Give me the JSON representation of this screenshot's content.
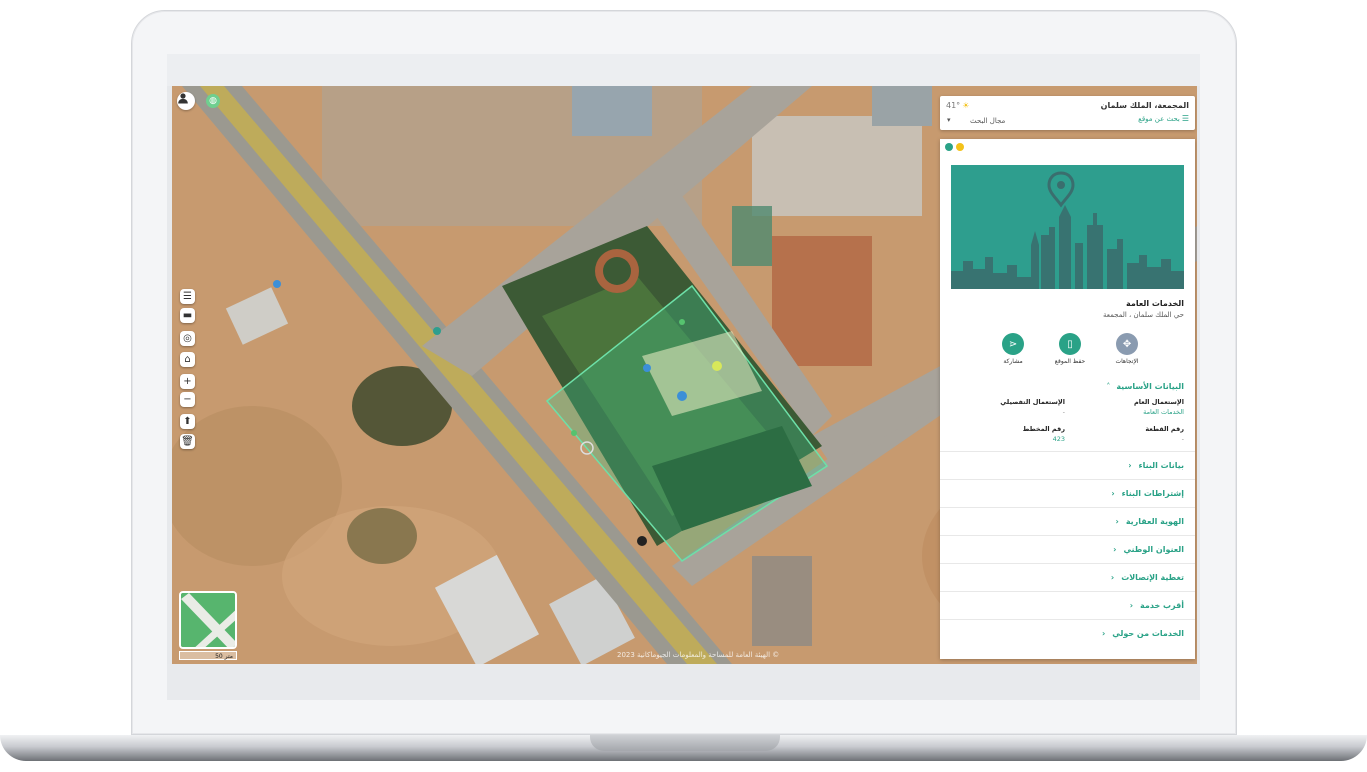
{
  "search": {
    "place": "المجمعة، الملك سلمان",
    "placeholder": "بحث عن موقع",
    "scope": "مجال البحث",
    "temperature": "41°"
  },
  "panel": {
    "title": "الخدمات العامة",
    "subtitle": "حي الملك سلمان ، المجمعة",
    "actions": [
      {
        "label": "الإتجاهات",
        "icon": "directions-icon",
        "color": "#8a9bb0"
      },
      {
        "label": "حفظ الموقع",
        "icon": "bookmark-icon",
        "color": "#2aa287"
      },
      {
        "label": "مشاركة",
        "icon": "share-icon",
        "color": "#2aa287"
      }
    ],
    "basic_section": {
      "title": "البيانات الأساسية",
      "fields": [
        {
          "label": "الإستعمال العام",
          "value": "الخدمات العامة"
        },
        {
          "label": "الإستعمال التفصيلي",
          "value": "-"
        },
        {
          "label": "رقم القطعة",
          "value": "-"
        },
        {
          "label": "رقم المخطط",
          "value": "423"
        }
      ]
    },
    "sections": [
      "بيانات البناء",
      "إشتراطات البناء",
      "الهوية العقارية",
      "العنوان الوطني",
      "تغطية الإتصالات",
      "أقرب خدمة",
      "الخدمات من حولي"
    ]
  },
  "map": {
    "scale": "50 متر",
    "attribution": "الهيئة العامة للمساحة والمعلومات الجيوماكانية 2023 ©"
  },
  "colors": {
    "accent": "#2aa287",
    "hero": "#2e9e8e"
  }
}
